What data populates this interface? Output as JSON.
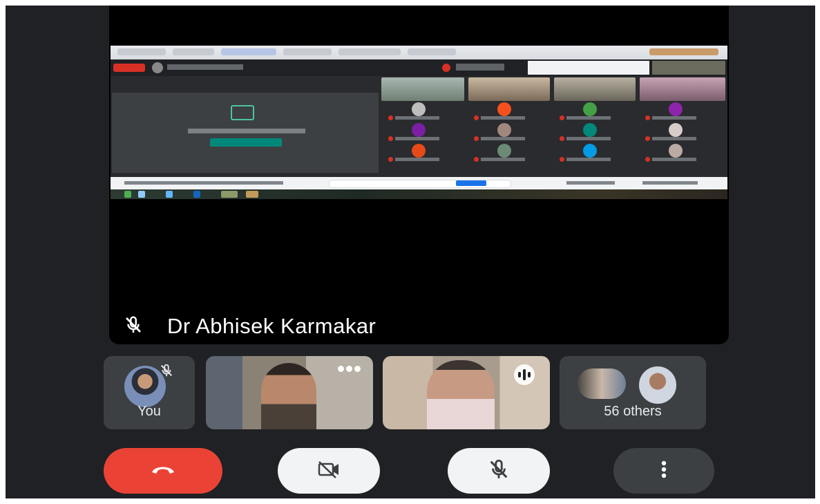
{
  "speaker": {
    "name": "Dr Abhisek Karmakar",
    "icon": "mic-off-icon"
  },
  "tiles": {
    "self_label": "You",
    "others_label": "56 others"
  },
  "controls": {
    "end_call_icon": "phone-hangup-icon",
    "camera_icon": "camera-off-icon",
    "mic_icon": "mic-off-icon",
    "more_icon": "more-vert-icon"
  },
  "colors": {
    "background": "#202124",
    "end_call": "#ea4335",
    "control_light": "#f1f3f4",
    "control_dark": "#3c4043",
    "tile": "#3c4043"
  }
}
